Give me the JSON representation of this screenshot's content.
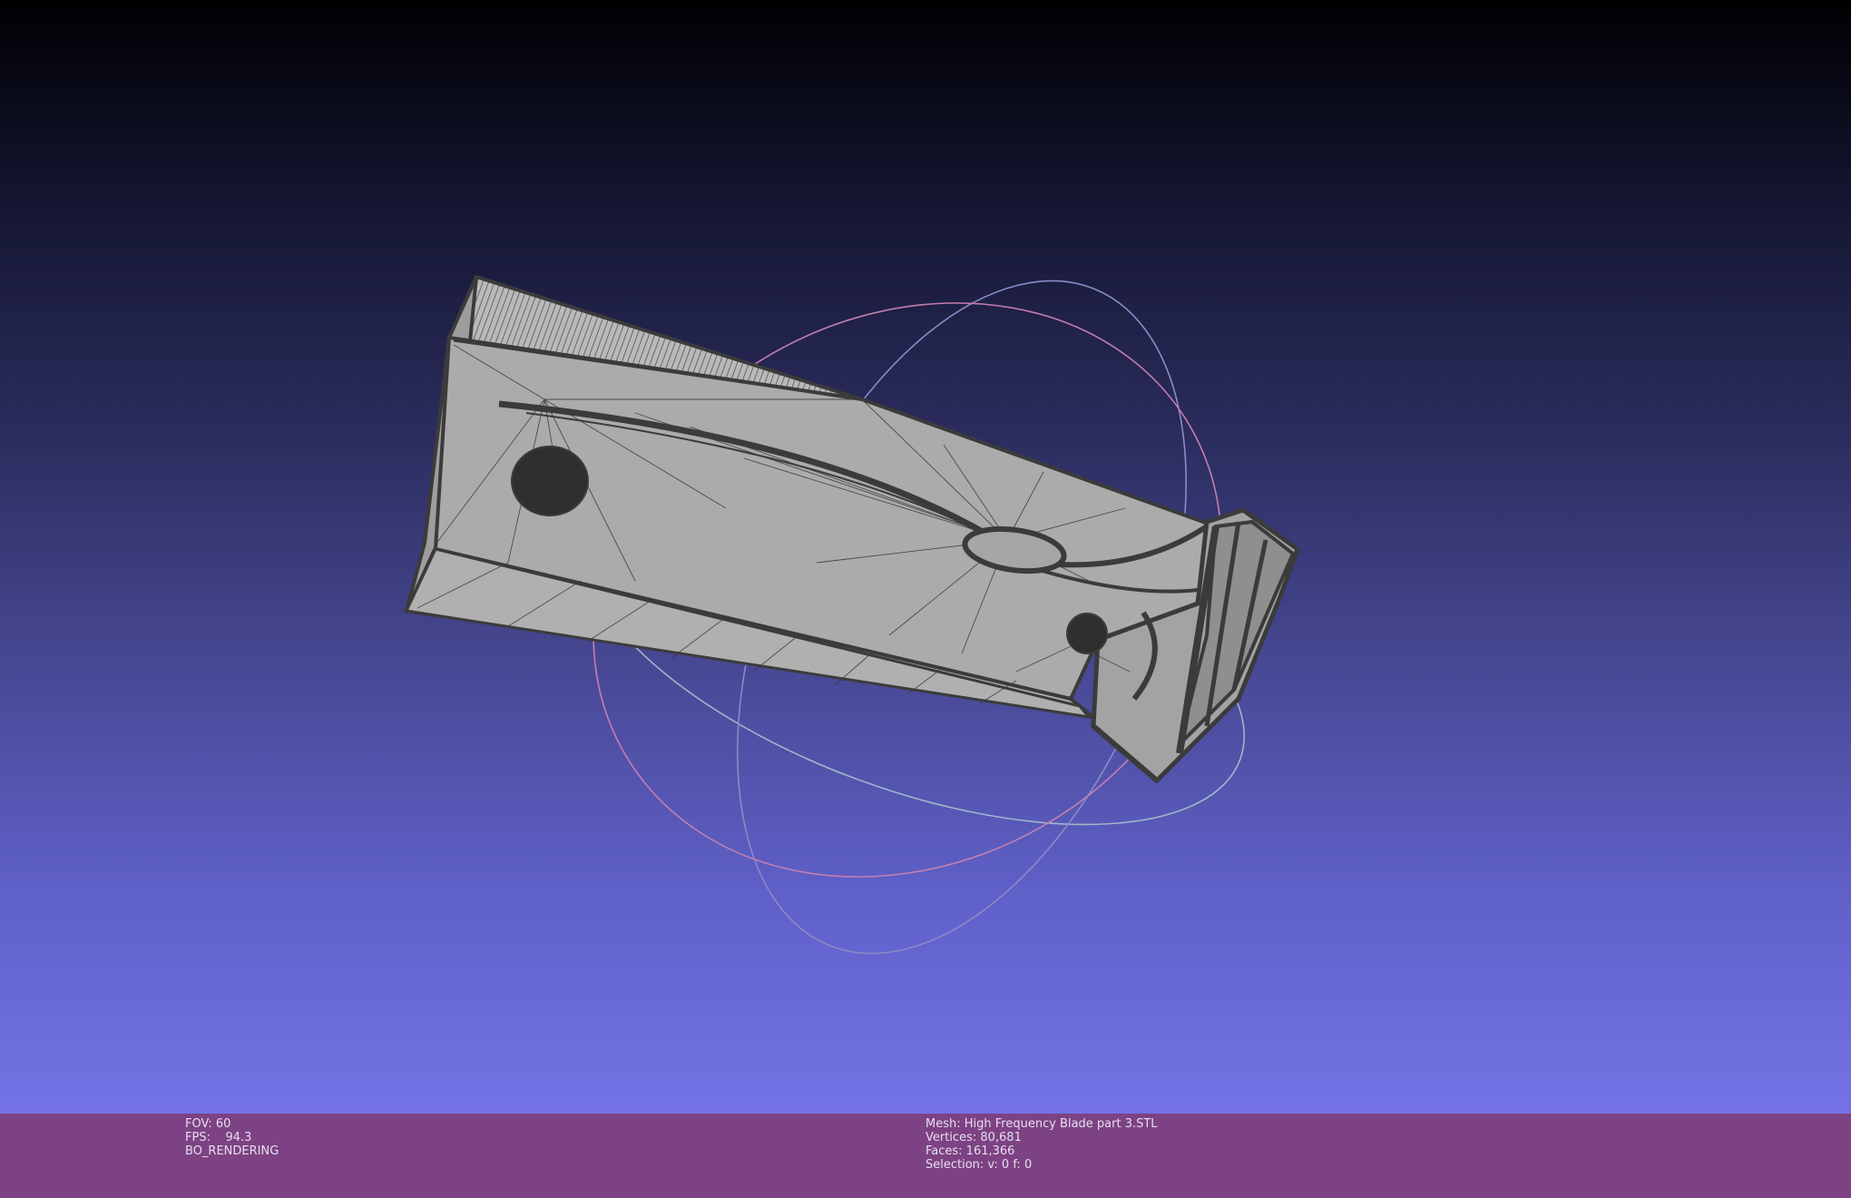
{
  "viewer": {
    "background_top": "#000002",
    "background_bottom": "#7473e6",
    "infobar_color": "#7d4283",
    "mesh_color": "#a8a8a8",
    "wire_color": "#3b3b3b"
  },
  "status_left": {
    "fov": "FOV: 60",
    "fps": "FPS:    94.3",
    "mode": "BO_RENDERING"
  },
  "status_right": {
    "mesh": "Mesh: High Frequency Blade part 3.STL",
    "vertices": "Vertices: 80,681",
    "faces": "Faces: 161,366",
    "selection": "Selection: v: 0 f: 0"
  },
  "icons": {
    "trackball": "trackball-gizmo-icon"
  }
}
